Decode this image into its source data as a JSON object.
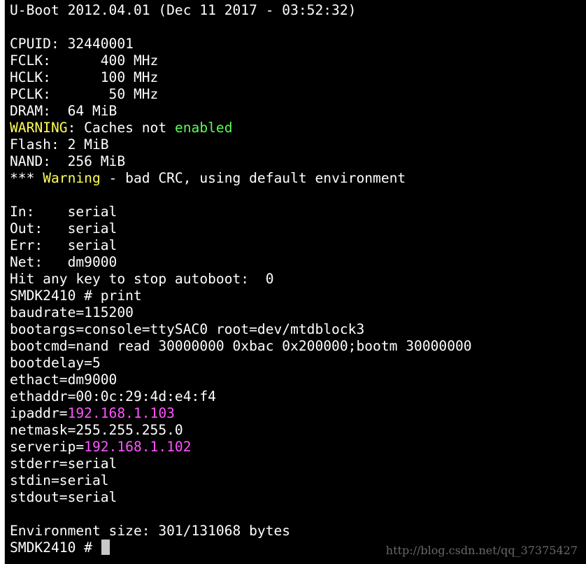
{
  "colors": {
    "background": "#000000",
    "text": "#ffffff",
    "yellow": "#ffff55",
    "green": "#55ff55",
    "magenta": "#ff55ff",
    "cursor": "#c8c8c8"
  },
  "terminal": {
    "lines": [
      [
        {
          "t": "U-Boot 2012.04.01 (Dec 11 2017 - 03:52:32)"
        }
      ],
      [],
      [
        {
          "t": "CPUID: 32440001"
        }
      ],
      [
        {
          "t": "FCLK:      400 MHz"
        }
      ],
      [
        {
          "t": "HCLK:      100 MHz"
        }
      ],
      [
        {
          "t": "PCLK:       50 MHz"
        }
      ],
      [
        {
          "t": "DRAM:  64 MiB"
        }
      ],
      [
        {
          "t": "WARNING",
          "c": "yellow"
        },
        {
          "t": ": Caches not "
        },
        {
          "t": "enabled",
          "c": "green"
        }
      ],
      [
        {
          "t": "Flash: 2 MiB"
        }
      ],
      [
        {
          "t": "NAND:  256 MiB"
        }
      ],
      [
        {
          "t": "*** "
        },
        {
          "t": "Warning",
          "c": "yellow"
        },
        {
          "t": " - bad CRC, using default environment"
        }
      ],
      [],
      [
        {
          "t": "In:    serial"
        }
      ],
      [
        {
          "t": "Out:   serial"
        }
      ],
      [
        {
          "t": "Err:   serial"
        }
      ],
      [
        {
          "t": "Net:   dm9000"
        }
      ],
      [
        {
          "t": "Hit any key to stop autoboot:  0"
        }
      ],
      [
        {
          "t": "SMDK2410 # print"
        }
      ],
      [
        {
          "t": "baudrate=115200"
        }
      ],
      [
        {
          "t": "bootargs=console=ttySAC0 root=dev/mtdblock3"
        }
      ],
      [
        {
          "t": "bootcmd=nand read 30000000 0xbac 0x200000;bootm 30000000"
        }
      ],
      [
        {
          "t": "bootdelay=5"
        }
      ],
      [
        {
          "t": "ethact=dm9000"
        }
      ],
      [
        {
          "t": "ethaddr=00:0c:29:4d:e4:f4"
        }
      ],
      [
        {
          "t": "ipaddr="
        },
        {
          "t": "192.168.1.103",
          "c": "magenta"
        }
      ],
      [
        {
          "t": "netmask=255.255.255.0"
        }
      ],
      [
        {
          "t": "serverip="
        },
        {
          "t": "192.168.1.102",
          "c": "magenta"
        }
      ],
      [
        {
          "t": "stderr=serial"
        }
      ],
      [
        {
          "t": "stdin=serial"
        }
      ],
      [
        {
          "t": "stdout=serial"
        }
      ],
      [],
      [
        {
          "t": "Environment size: 301/131068 bytes"
        }
      ]
    ],
    "prompt": "SMDK2410 # "
  },
  "watermark": "http://blog.csdn.net/qq_37375427"
}
